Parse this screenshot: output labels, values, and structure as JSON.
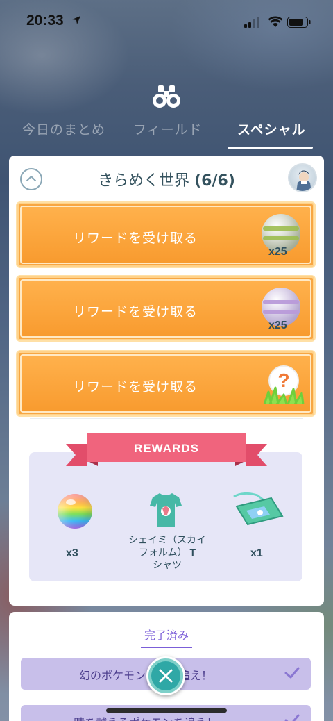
{
  "status_bar": {
    "time": "20:33"
  },
  "tabs": [
    {
      "label": "今日のまとめ",
      "active": false
    },
    {
      "label": "フィールド",
      "active": false
    },
    {
      "label": "スペシャル",
      "active": true
    }
  ],
  "card": {
    "title": "きらめく世界",
    "progress": "(6/6)",
    "rewards": [
      {
        "label": "リワードを受け取る",
        "item": "great-ball",
        "quantity": "x25"
      },
      {
        "label": "リワードを受け取る",
        "item": "rare-ball",
        "quantity": "x25"
      },
      {
        "label": "リワードを受け取る",
        "item": "mystery-encounter",
        "quantity": ""
      }
    ]
  },
  "rewards_panel": {
    "banner": "REWARDS",
    "items": [
      {
        "name": "rainbow-ball",
        "label": "x3"
      },
      {
        "name": "tshirt",
        "label": "シェイミ（スカイフォルム）",
        "label_suffix": "T",
        "label_line3": "シャツ"
      },
      {
        "name": "ticket",
        "label": "x1"
      }
    ]
  },
  "completed": {
    "tab_label": "完了済み",
    "items": [
      {
        "text": "幻のポケモンの姿を追え！"
      },
      {
        "text": "時を越えるポケモンを追え！"
      }
    ]
  },
  "colors": {
    "accent_orange": "#f7a642",
    "panel_lavender": "#e6e6f7",
    "ribbon_pink": "#f0647d",
    "teal": "#2fa8a6",
    "purple": "#7b5ed8"
  }
}
